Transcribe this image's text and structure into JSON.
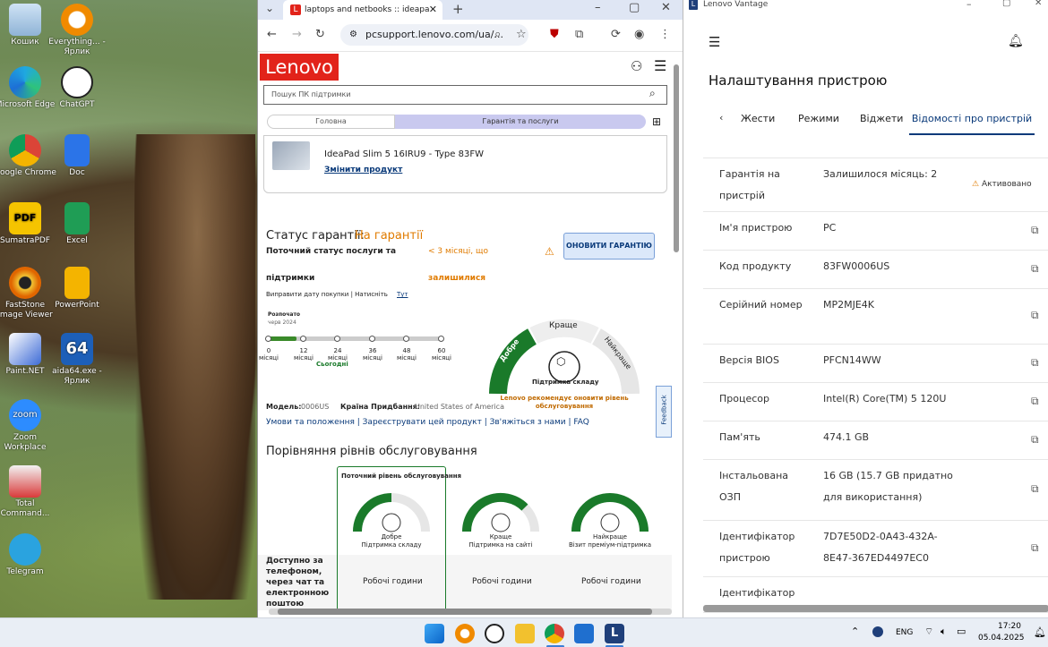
{
  "desktop": {
    "icons": [
      {
        "label": "Кошик"
      },
      {
        "label": "Everything... - Ярлик"
      },
      {
        "label": "Microsoft Edge"
      },
      {
        "label": "ChatGPT"
      },
      {
        "label": "Google Chrome"
      },
      {
        "label": "Doc"
      },
      {
        "label": "SumatraPDF"
      },
      {
        "label": "Excel"
      },
      {
        "label": "FastStone Image Viewer"
      },
      {
        "label": "PowerPoint"
      },
      {
        "label": "Paint.NET"
      },
      {
        "label": "aida64.exe - Ярлик"
      },
      {
        "label": "Zoom Workplace"
      },
      {
        "label": "Total Command..."
      },
      {
        "label": "Telegram"
      }
    ]
  },
  "browser": {
    "tab_title": "laptops and netbooks :: ideapa",
    "url": "pcsupport.lenovo.com/ua/...",
    "page": {
      "logo": "Lenovo",
      "search_placeholder": "Пошук ПК підтримки",
      "crumb_home": "Головна",
      "crumb_warranty": "Гарантія та послуги",
      "product_name": "IdeaPad Slim 5 16IRU9 - Type 83FW",
      "change_product": "Змінити продукт",
      "warranty_status_label": "Статус гарантії:",
      "warranty_status_value": "На гарантії",
      "current_status_line1": "Поточний статус послуги та",
      "current_status_line2": "підтримки",
      "remaining_line1": "< 3 місяці, що",
      "remaining_line2": "залишилися",
      "update_button": "ОНОВИТИ ГАРАНТІЮ",
      "fix_date": "Виправити дату покупки | Натисніть",
      "fix_date_link": "Тут",
      "started": "Розпочато",
      "started_date": "черв 2024",
      "timeline": [
        "0",
        "12",
        "24",
        "36",
        "48",
        "60"
      ],
      "months": "місяці",
      "today": "Сьогодні",
      "gauge_good": "Добре",
      "gauge_better": "Краще",
      "gauge_best": "Найкраще",
      "gauge_center": "Підтримка складу",
      "recommend": "Lenovo рекомендує оновити рівень обслуговування",
      "model_label": "Модель:",
      "model_value": "0006US",
      "country_label": "Країна Придбання:",
      "country_value": "United States of America",
      "links": [
        "Умови та положення",
        "Зареєструвати цей продукт",
        "Зв'яжіться з нами",
        "FAQ"
      ],
      "compare_title": "Порівняння рівнів обслуговування",
      "current_level": "Поточний рівень обслуговування",
      "levels": [
        {
          "name": "Добре",
          "desc": "Підтримка складу"
        },
        {
          "name": "Краще",
          "desc": "Підтримка на сайті"
        },
        {
          "name": "Найкраще",
          "desc": "Візит преміум-підтримка"
        }
      ],
      "row_label": "Доступно за телефоном, через чат та електронною поштою",
      "hours": "Робочі години",
      "feedback": "Feedback"
    }
  },
  "vantage": {
    "app_title": "Lenovo Vantage",
    "page_title": "Налаштування пристрою",
    "tabs": [
      "Жести",
      "Режими",
      "Віджети",
      "Відомості про пристрій"
    ],
    "rows": [
      {
        "k": "Гарантія на пристрій",
        "v": "Залишилося місяць: 2",
        "badge": "Активовано"
      },
      {
        "k": "Ім'я пристрою",
        "v": "PC"
      },
      {
        "k": "Код продукту",
        "v": "83FW0006US"
      },
      {
        "k": "Серійний номер",
        "v": "MP2MJE4K"
      },
      {
        "k": "Версія BIOS",
        "v": "PFCN14WW"
      },
      {
        "k": "Процесор",
        "v": "Intel(R) Core(TM) 5 120U"
      },
      {
        "k": "Пам'ять",
        "v": "474.1 GB"
      },
      {
        "k": "Інстальована ОЗП",
        "v": "16 GB (15.7 GB придатно для використання)"
      },
      {
        "k": "Ідентифікатор пристрою",
        "v": "7D7E50D2-0A43-432A-8E47-367ED4497EC0"
      },
      {
        "k": "Ідентифікатор",
        "v": ""
      }
    ]
  },
  "taskbar": {
    "lang": "ENG",
    "time": "17:20",
    "date": "05.04.2025"
  },
  "colors": {
    "lenovo_red": "#e2231a",
    "accent": "#0a3a7a",
    "warranty": "#e07b00",
    "green": "#1a7a2a"
  }
}
